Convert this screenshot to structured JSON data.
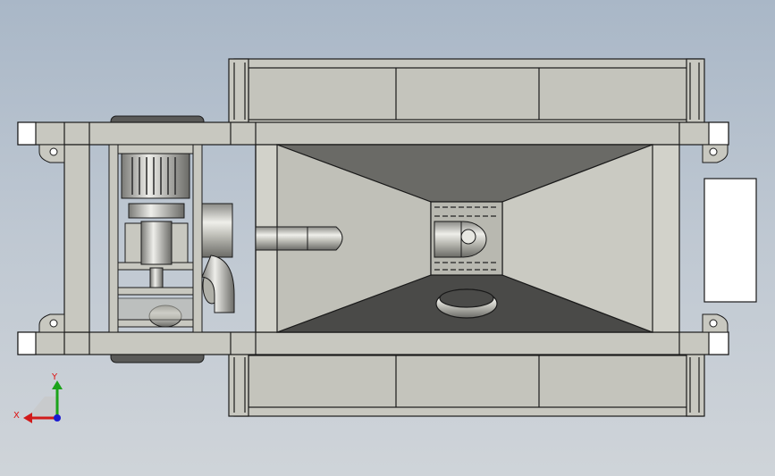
{
  "viewport": {
    "background_top": "#a9b7c7",
    "background_bottom": "#cfd4d9",
    "model_color": "#c8c8c0",
    "edge_color": "#1a1a1a",
    "shadow_color": "#4a4a48"
  },
  "triad": {
    "x_label": "X",
    "y_label": "Y",
    "x_color": "#d11a1a",
    "y_color": "#1aa31a",
    "z_color": "#1a1ad1"
  }
}
